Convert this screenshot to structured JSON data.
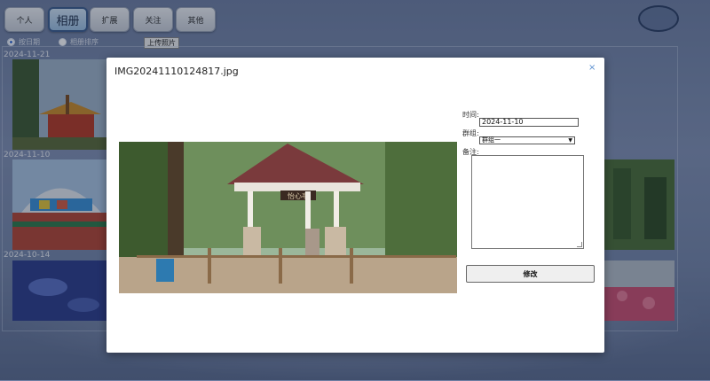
{
  "nav": {
    "items": [
      {
        "label": "个人",
        "active": false
      },
      {
        "label": "相册",
        "active": true
      },
      {
        "label": "扩展",
        "active": false
      },
      {
        "label": "关注",
        "active": false
      },
      {
        "label": "其他",
        "active": false
      }
    ]
  },
  "sort": {
    "option_date": "按日期",
    "option_group": "相册排序",
    "upload_label": "上传照片"
  },
  "gallery": {
    "dates": [
      "2024-11-21",
      "2024-11-10",
      "2024-10-14"
    ]
  },
  "modal": {
    "title": "IMG20241110124817.jpg",
    "close_glyph": "×",
    "sign_text": "怡心亭",
    "form": {
      "time_label": "时间:",
      "time_value": "2024-11-10",
      "group_label": "群组:",
      "group_value": "群组一",
      "notes_label": "备注:",
      "notes_value": "",
      "submit_label": "修改"
    }
  },
  "colors": {
    "accent": "#3d5c8e",
    "close": "#5a8fd0"
  }
}
